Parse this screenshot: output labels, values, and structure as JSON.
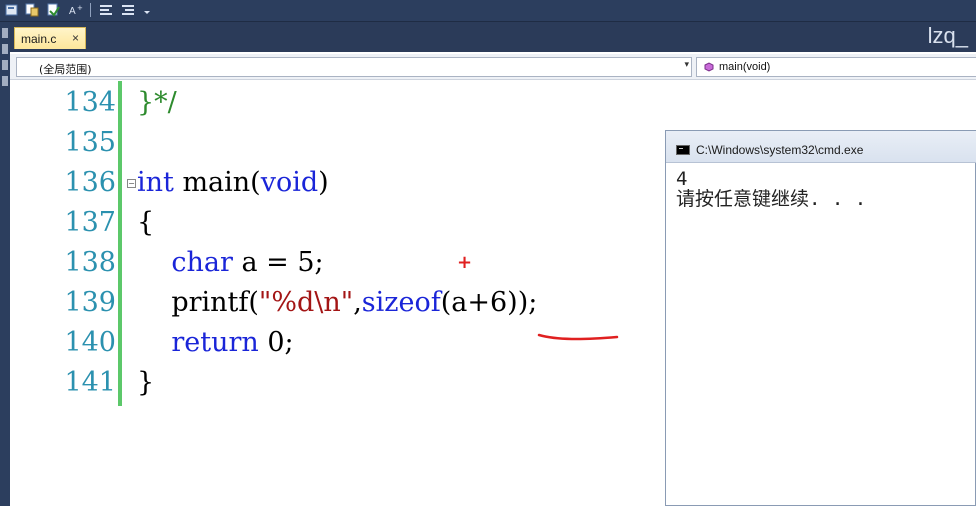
{
  "tab": {
    "label": "main.c",
    "close": "×"
  },
  "window_label": "lzq_",
  "nav": {
    "scope": "(全局范围)",
    "function": "main(void)"
  },
  "code_lines": [
    {
      "num": "134",
      "code": "}*/"
    },
    {
      "num": "135",
      "code": ""
    },
    {
      "num": "136",
      "code": "int main(void)"
    },
    {
      "num": "137",
      "code": "{"
    },
    {
      "num": "138",
      "code": "    char a = 5;"
    },
    {
      "num": "139",
      "code": "    printf(\"%d\\n\",sizeof(a+6));"
    },
    {
      "num": "140",
      "code": "    return 0;"
    },
    {
      "num": "141",
      "code": "}"
    }
  ],
  "console": {
    "title": "C:\\Windows\\system32\\cmd.exe",
    "output_line1": "4",
    "output_line2": "请按任意键继续. . ."
  },
  "colors": {
    "keyword": "#1a25d8",
    "comment": "#2e8b2e",
    "line_number": "#2b91af",
    "annotation": "#e02020"
  }
}
